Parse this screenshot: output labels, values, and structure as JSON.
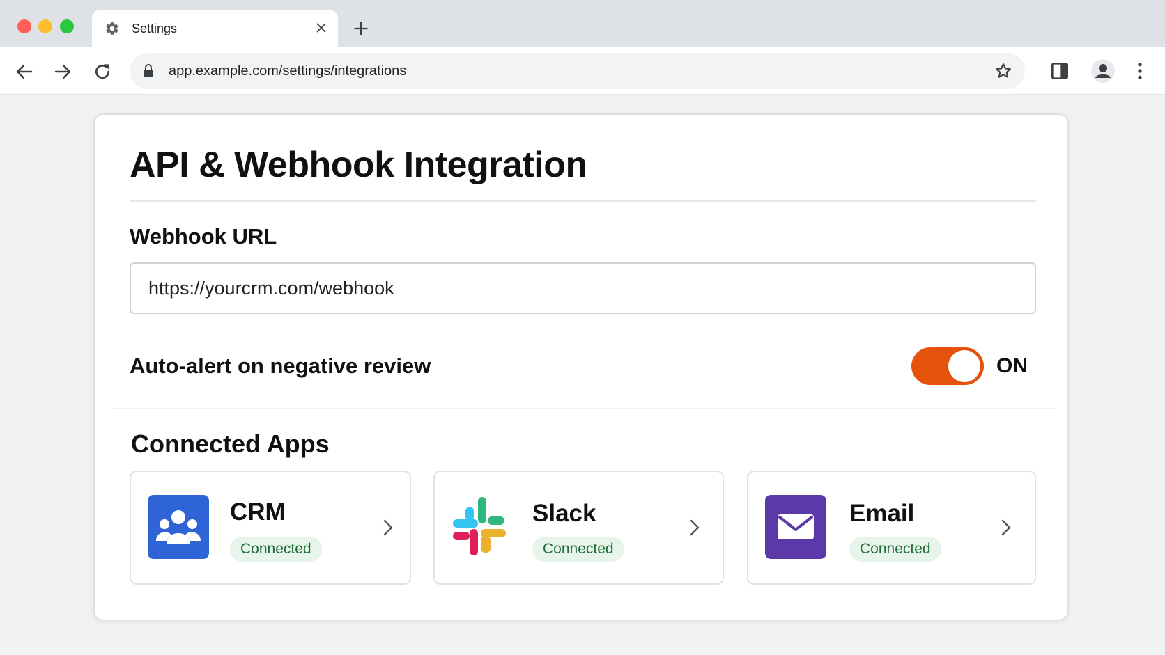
{
  "browser": {
    "tab_title": "Settings",
    "url": "app.example.com/settings/integrations"
  },
  "page": {
    "title": "API & Webhook Integration",
    "webhook": {
      "label": "Webhook URL",
      "value": "https://yourcrm.com/webhook"
    },
    "auto_alert": {
      "label": "Auto-alert on negative review",
      "enabled": true,
      "state_text": "ON",
      "toggle_color": "#e4520b"
    },
    "connected_apps": {
      "title": "Connected Apps",
      "apps": [
        {
          "name": "CRM",
          "status": "Connected",
          "icon": "users-icon",
          "color": "#2e64d6"
        },
        {
          "name": "Slack",
          "status": "Connected",
          "icon": "slack-logo-icon"
        },
        {
          "name": "Email",
          "status": "Connected",
          "icon": "envelope-icon",
          "color": "#5b39a8"
        }
      ]
    }
  }
}
